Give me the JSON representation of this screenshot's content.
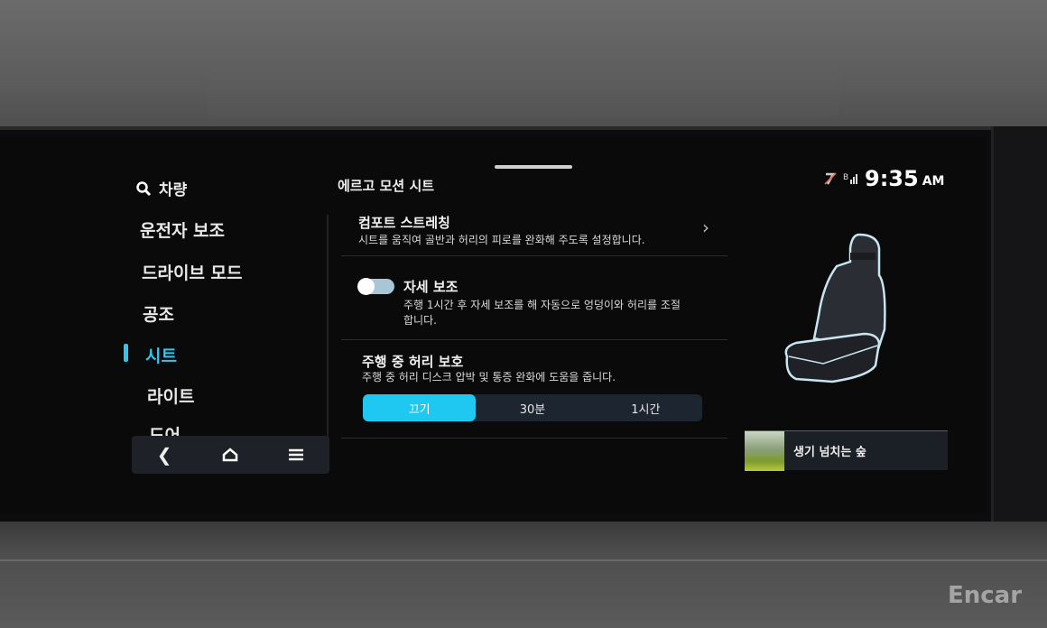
{
  "sidebar": {
    "header": "차량",
    "search_icon": "search-icon",
    "items": [
      {
        "label": "운전자 보조",
        "active": false
      },
      {
        "label": "드라이브 모드",
        "active": false
      },
      {
        "label": "공조",
        "active": false
      },
      {
        "label": "시트",
        "active": true
      },
      {
        "label": "라이트",
        "active": false
      },
      {
        "label": "도어",
        "active": false
      }
    ],
    "bottom_nav": [
      "back-icon",
      "home-icon",
      "menu-icon"
    ]
  },
  "main": {
    "title": "에르고 모션 시트",
    "rows": [
      {
        "title": "컴포트 스트레칭",
        "desc": "시트를 움직여 골반과 허리의 피로를 완화해 주도록 설정합니다."
      },
      {
        "title": "자세 보조",
        "desc": "주행 1시간 후 자세 보조를 해 자동으로 엉덩이와 허리를 조절합니다.",
        "toggle_on": false
      },
      {
        "title": "주행 중 허리 보호",
        "desc": "주행 중 허리 디스크 압박 및 통증 완화에 도움을 줍니다.",
        "options": [
          "끄기",
          "30분",
          "1시간"
        ],
        "selected": "끄기"
      }
    ]
  },
  "status": {
    "time": "9:35",
    "ampm": "AM",
    "icons": [
      "phone-muted-icon",
      "bluetooth-signal-icon"
    ]
  },
  "media": {
    "title": "생기 넘치는 숲"
  },
  "watermark": "Encar",
  "colors": {
    "accent": "#1fc8f0",
    "background": "#0a0a0b"
  }
}
